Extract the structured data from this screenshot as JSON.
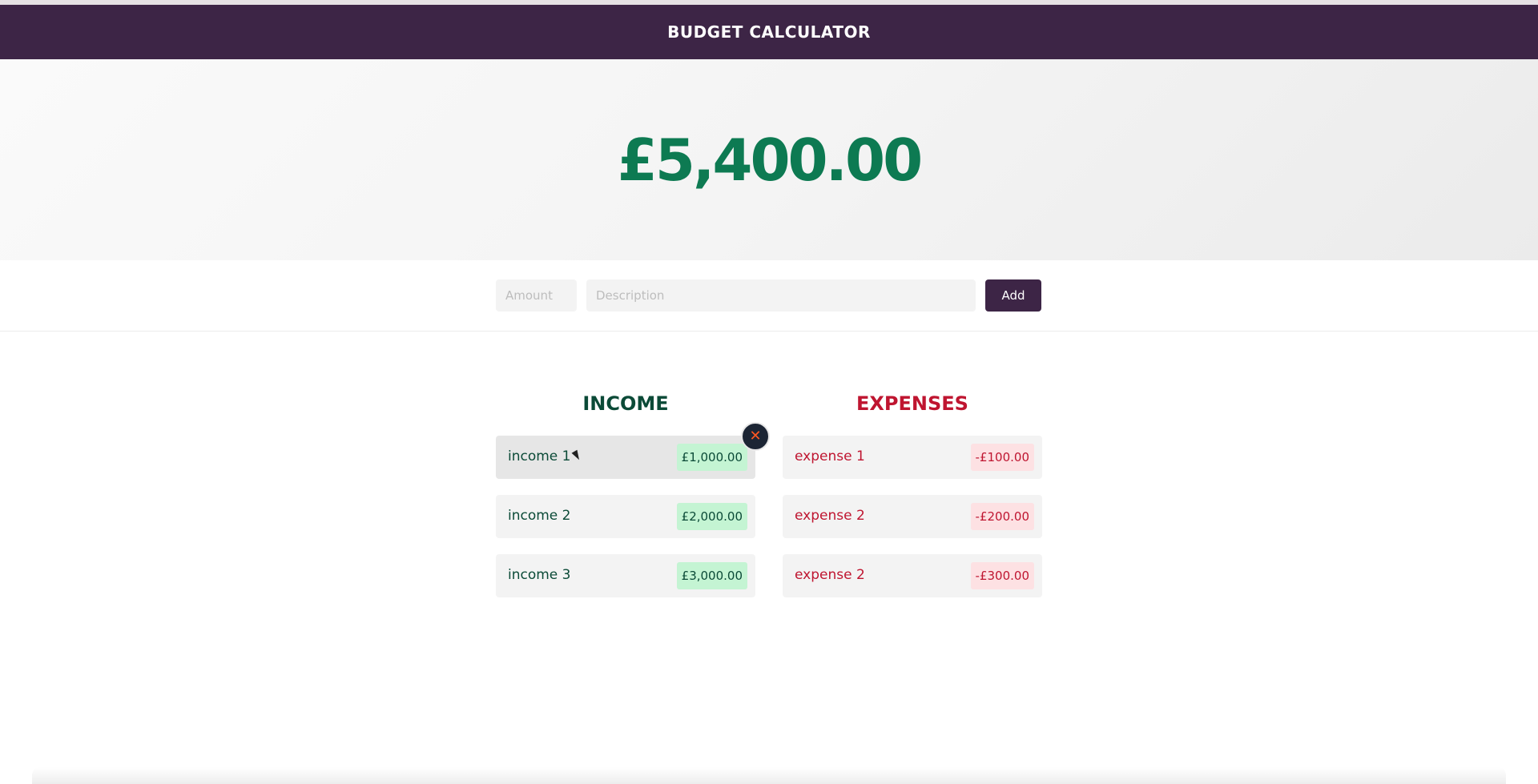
{
  "header": {
    "title": "BUDGET CALCULATOR"
  },
  "balance": {
    "value": "£5,400.00"
  },
  "form": {
    "amount_placeholder": "Amount",
    "description_placeholder": "Description",
    "add_label": "Add"
  },
  "income": {
    "title": "INCOME",
    "items": [
      {
        "description": "income 1",
        "value": "£1,000.00"
      },
      {
        "description": "income 2",
        "value": "£2,000.00"
      },
      {
        "description": "income 3",
        "value": "£3,000.00"
      }
    ]
  },
  "expenses": {
    "title": "EXPENSES",
    "items": [
      {
        "description": "expense 1",
        "value": "-£100.00"
      },
      {
        "description": "expense 2",
        "value": "-£200.00"
      },
      {
        "description": "expense 2",
        "value": "-£300.00"
      }
    ]
  },
  "icons": {
    "remove": "close-icon"
  },
  "colors": {
    "brand": "#3d2546",
    "balance": "#0d7a52",
    "income_text": "#0b4a37",
    "income_badge": "#c4f4d3",
    "expense_text": "#bf1530",
    "expense_badge": "#fde1e3",
    "remove_button": "#1c2534",
    "remove_icon": "#ff5722"
  }
}
